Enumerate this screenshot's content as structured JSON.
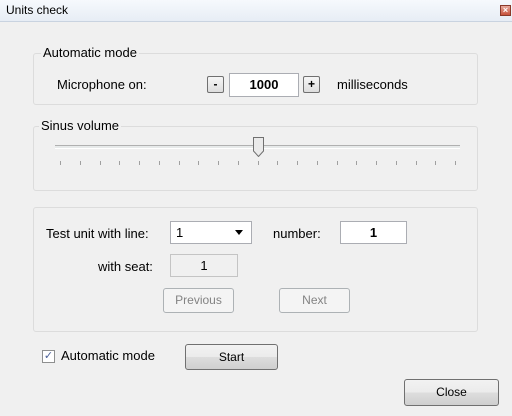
{
  "window": {
    "title": "Units check",
    "close_glyph": "×"
  },
  "automatic_group": {
    "title": "Automatic mode",
    "microphone_label": "Microphone on:",
    "minus_label": "-",
    "value": "1000",
    "plus_label": "+",
    "unit_label": "milliseconds"
  },
  "sinus_group": {
    "title": "Sinus volume",
    "slider_position": 0.5,
    "tick_count": 21
  },
  "test_group": {
    "line_label": "Test unit with line:",
    "line_value": "1",
    "number_label": "number:",
    "number_value": "1",
    "seat_label": "with seat:",
    "seat_value": "1",
    "previous_label": "Previous",
    "next_label": "Next"
  },
  "footer": {
    "auto_checkbox_checked": true,
    "auto_checkbox_label": "Automatic mode",
    "start_label": "Start",
    "close_label": "Close"
  }
}
